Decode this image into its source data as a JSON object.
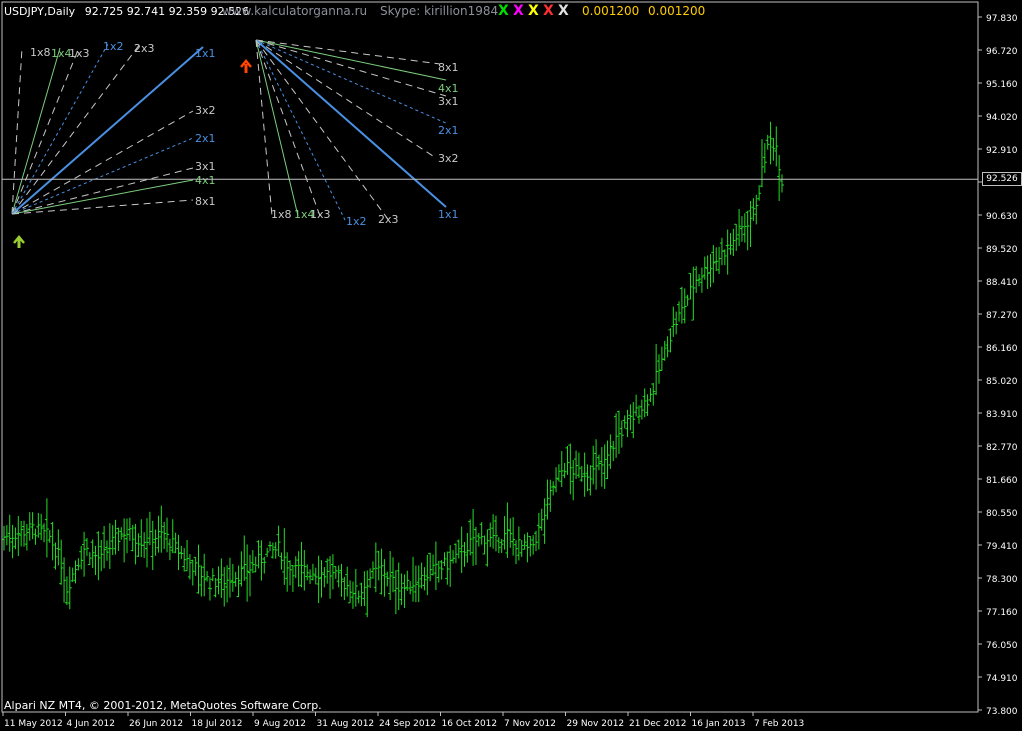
{
  "header": {
    "symbol": "USDJPY,Daily",
    "ohlc": "92.725 92.741 92.359 92.526",
    "site": "www.kalculatorganna.ru",
    "skype": "Skype: kirillion1984",
    "x_marks": [
      {
        "char": "X",
        "color": "#00e000"
      },
      {
        "char": "X",
        "color": "#ff00ff"
      },
      {
        "char": "X",
        "color": "#ffff00"
      },
      {
        "char": "X",
        "color": "#ff3030"
      },
      {
        "char": "X",
        "color": "#e0e0e0"
      }
    ],
    "value1": "0.001200",
    "value2": "0.001200",
    "value_color": "#ffcc00"
  },
  "footer": {
    "copyright": "Alpari NZ MT4, © 2001-2012, MetaQuotes Software Corp."
  },
  "current_price": "92.526",
  "colors": {
    "background": "#000000",
    "bars": "#22dd22",
    "axis": "#c0c0c0",
    "text": "#ffffff",
    "gann_main": "#4a90e2",
    "gann_green": "#7ccd7c",
    "gann_dashed": "#c8c8c8",
    "arrow_up": "#9acd32",
    "arrow_down": "#ff4500"
  },
  "chart_data": {
    "type": "ohlc",
    "symbol": "USDJPY",
    "timeframe": "Daily",
    "ylim": [
      73.8,
      98.25
    ],
    "y_ticks": [
      "97.830",
      "96.720",
      "95.160",
      "94.020",
      "92.910",
      "91.770",
      "90.630",
      "89.520",
      "88.410",
      "87.270",
      "86.160",
      "85.020",
      "83.910",
      "82.770",
      "81.660",
      "80.550",
      "79.410",
      "78.300",
      "77.160",
      "76.050",
      "74.910",
      "73.800"
    ],
    "x_ticks": [
      "11 May 2012",
      "4 Jun 2012",
      "26 Jun 2012",
      "18 Jul 2012",
      "9 Aug 2012",
      "31 Aug 2012",
      "24 Sep 2012",
      "16 Oct 2012",
      "7 Nov 2012",
      "29 Nov 2012",
      "21 Dec 2012",
      "16 Jan 2013",
      "7 Feb 2013"
    ],
    "close_anchors": [
      [
        0,
        79.9
      ],
      [
        10,
        80.2
      ],
      [
        16,
        79.9
      ],
      [
        20,
        79.0
      ],
      [
        22,
        78.1
      ],
      [
        24,
        78.6
      ],
      [
        28,
        79.5
      ],
      [
        34,
        79.1
      ],
      [
        38,
        79.7
      ],
      [
        42,
        80.1
      ],
      [
        48,
        79.8
      ],
      [
        56,
        80.0
      ],
      [
        60,
        79.5
      ],
      [
        66,
        78.9
      ],
      [
        72,
        78.3
      ],
      [
        78,
        78.4
      ],
      [
        86,
        78.8
      ],
      [
        92,
        79.3
      ],
      [
        96,
        79.5
      ],
      [
        100,
        78.8
      ],
      [
        106,
        78.7
      ],
      [
        114,
        78.6
      ],
      [
        120,
        78.2
      ],
      [
        124,
        77.9
      ],
      [
        128,
        78.5
      ],
      [
        132,
        78.8
      ],
      [
        136,
        78.3
      ],
      [
        140,
        78.1
      ],
      [
        145,
        78.4
      ],
      [
        150,
        78.7
      ],
      [
        156,
        79.0
      ],
      [
        162,
        79.6
      ],
      [
        168,
        79.9
      ],
      [
        172,
        79.7
      ],
      [
        176,
        80.0
      ],
      [
        180,
        79.6
      ],
      [
        184,
        79.4
      ],
      [
        188,
        80.4
      ],
      [
        192,
        81.7
      ],
      [
        196,
        82.4
      ],
      [
        200,
        82.2
      ],
      [
        206,
        82.2
      ],
      [
        210,
        82.5
      ],
      [
        214,
        83.4
      ],
      [
        218,
        83.9
      ],
      [
        222,
        84.4
      ],
      [
        226,
        84.9
      ],
      [
        230,
        86.1
      ],
      [
        234,
        87.3
      ],
      [
        238,
        88.1
      ],
      [
        242,
        89.0
      ],
      [
        246,
        89.4
      ],
      [
        250,
        89.8
      ],
      [
        254,
        90.2
      ],
      [
        258,
        90.8
      ],
      [
        262,
        91.3
      ],
      [
        264,
        92.2
      ],
      [
        266,
        93.3
      ],
      [
        268,
        93.9
      ],
      [
        270,
        93.7
      ],
      [
        272,
        92.5
      ]
    ],
    "total_bars": 273,
    "gann_fans": [
      {
        "direction": "up",
        "labels": [
          "1x8",
          "1x4",
          "1x3",
          "1x2",
          "2x3",
          "1x1",
          "3x2",
          "2x1",
          "3x1",
          "4x1",
          "8x1"
        ]
      },
      {
        "direction": "down",
        "labels": [
          "8x1",
          "4x1",
          "3x1",
          "2x1",
          "3x2",
          "1x1",
          "2x3",
          "1x2",
          "1x3",
          "1x4",
          "1x8"
        ]
      }
    ],
    "horizontal_line": 92.526,
    "grid": false
  }
}
